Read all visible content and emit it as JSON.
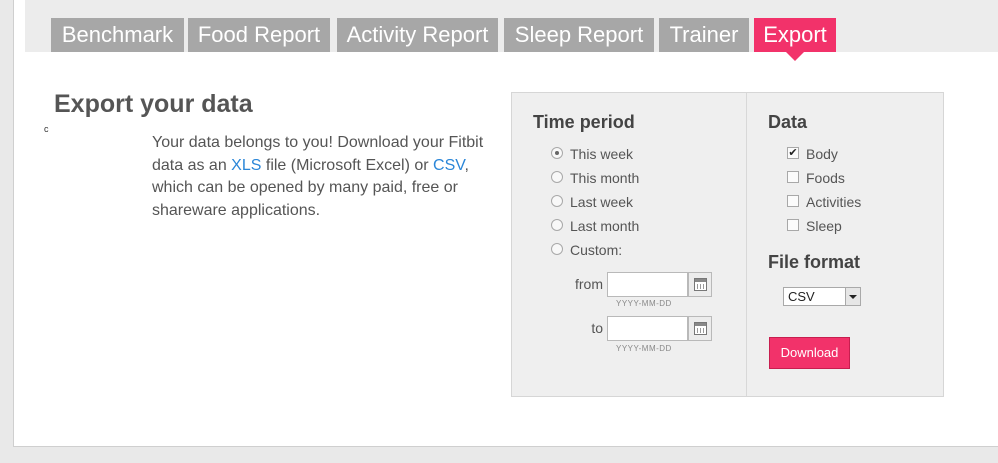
{
  "tabs": [
    {
      "label": "Benchmark",
      "active": false
    },
    {
      "label": "Food Report",
      "active": false
    },
    {
      "label": "Activity Report",
      "active": false
    },
    {
      "label": "Sleep Report",
      "active": false
    },
    {
      "label": "Trainer",
      "active": false
    },
    {
      "label": "Export",
      "active": true
    }
  ],
  "page": {
    "title": "Export your data",
    "stray_mark": "c",
    "intro": {
      "part1": "Your data belongs to you! Download your Fitbit data as an ",
      "xls_link": "XLS",
      "part2": " file (Microsoft Excel) or ",
      "csv_link": "CSV",
      "part3": ", which can be opened by many paid, free or shareware applications."
    }
  },
  "time_period": {
    "heading": "Time period",
    "options": [
      {
        "label": "This week",
        "selected": true
      },
      {
        "label": "This month",
        "selected": false
      },
      {
        "label": "Last week",
        "selected": false
      },
      {
        "label": "Last month",
        "selected": false
      },
      {
        "label": "Custom:",
        "selected": false
      }
    ],
    "from_label": "from",
    "to_label": "to",
    "from_value": "",
    "to_value": "",
    "date_hint": "YYYY-MM-DD"
  },
  "data_section": {
    "heading": "Data",
    "options": [
      {
        "label": "Body",
        "checked": true
      },
      {
        "label": "Foods",
        "checked": false
      },
      {
        "label": "Activities",
        "checked": false
      },
      {
        "label": "Sleep",
        "checked": false
      }
    ]
  },
  "file_format": {
    "heading": "File format",
    "selected": "CSV"
  },
  "download_label": "Download",
  "colors": {
    "accent": "#f2326a",
    "tab_inactive": "#a7a7a7",
    "link": "#2a86d8"
  }
}
